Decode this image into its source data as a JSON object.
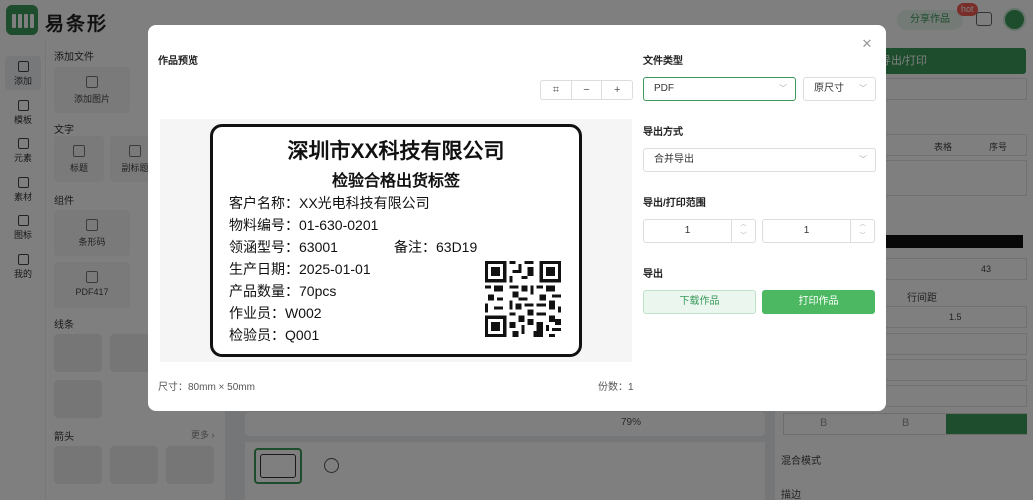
{
  "app": {
    "logo_text": "易条形",
    "share_label": "分享作品",
    "hot_badge": "hot"
  },
  "leftnav": {
    "items": [
      {
        "label": "添加",
        "icon": "plus-square-icon"
      },
      {
        "label": "模板",
        "icon": "grid-icon"
      },
      {
        "label": "元素",
        "icon": "shapes-icon"
      },
      {
        "label": "素材",
        "icon": "folder-icon"
      },
      {
        "label": "图标",
        "icon": "star-icon"
      },
      {
        "label": "我的",
        "icon": "user-icon"
      }
    ]
  },
  "panel": {
    "add_file": "添加文件",
    "add_image": "添加图片",
    "text": "文字",
    "heading": "标题",
    "subheading": "副标题",
    "components": "组件",
    "barcode": "条形码",
    "pdf417": "PDF417",
    "lines": "线条",
    "arrows": "箭头",
    "more": "更多 ›"
  },
  "canvas": {
    "zoom": "79%"
  },
  "rightpanel": {
    "export_print": "导出/打印",
    "table": "表格",
    "serial": "序号",
    "font_size": "43",
    "line_spacing_label": "行间距",
    "line_spacing": "1.5",
    "bold_mark": "B",
    "blend_mode": "混合模式",
    "stroke": "描边"
  },
  "modal": {
    "preview_title": "作品预览",
    "zoom_fit": "⌗",
    "zoom_out": "−",
    "zoom_in": "+",
    "label": {
      "company": "深圳市XX科技有限公司",
      "subtitle": "检验合格出货标签",
      "customer": "客户名称：XX光电科技有限公司",
      "material": "物料编号：01-630-0201",
      "model": "领涵型号：63001",
      "note": "备注：63D19",
      "date": "生产日期：2025-01-01",
      "quantity": "产品数量：70pcs",
      "operator": "作业员：W002",
      "inspector": "检验员：Q001"
    },
    "size": "尺寸：80mm × 50mm",
    "copies": "份数：1",
    "file_type_label": "文件类型",
    "file_type": "PDF",
    "scale": "原尺寸",
    "export_mode_label": "导出方式",
    "export_mode": "合并导出",
    "range_label": "导出/打印范围",
    "range_from": "1",
    "range_to": "1",
    "export_label": "导出",
    "download_label": "下载作品",
    "print_label": "打印作品",
    "accent": "#3a9a5a"
  }
}
